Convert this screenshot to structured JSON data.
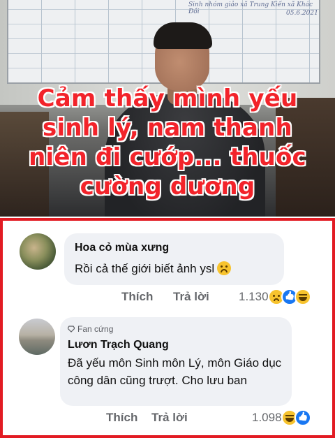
{
  "news": {
    "headline_lines": [
      "Cảm thấy mình yếu",
      "sinh lý, nam thanh",
      "niên đi cướp... thuốc",
      "cường dương"
    ],
    "board_text": [
      "Sinh nhóm giảo xã Trung Kiến xã Khác Đồi",
      "05.6.2021"
    ]
  },
  "comments": [
    {
      "author": "Hoa cỏ mùa xưng",
      "text": "Rồi cả thế giới biết ảnh ysl",
      "inline_emoji": "upside-down-face",
      "actions": {
        "like": "Thích",
        "reply": "Trả lời"
      },
      "reaction_count": "1.130",
      "reactions": [
        "sad",
        "like",
        "haha"
      ]
    },
    {
      "badge": "Fan cứng",
      "author": "Lươn Trạch Quang",
      "text": "Đã yếu môn Sinh môn Lý, môn Giáo dục công dân cũng trượt. Cho lưu ban",
      "actions": {
        "like": "Thích",
        "reply": "Trả lời"
      },
      "reaction_count": "1.098",
      "reactions": [
        "haha",
        "like"
      ]
    }
  ],
  "colors": {
    "headline": "#f2232a",
    "panel_border": "#e21b23",
    "bubble": "#eff1f5",
    "muted": "#65676b",
    "like_blue": "#1877f2"
  }
}
